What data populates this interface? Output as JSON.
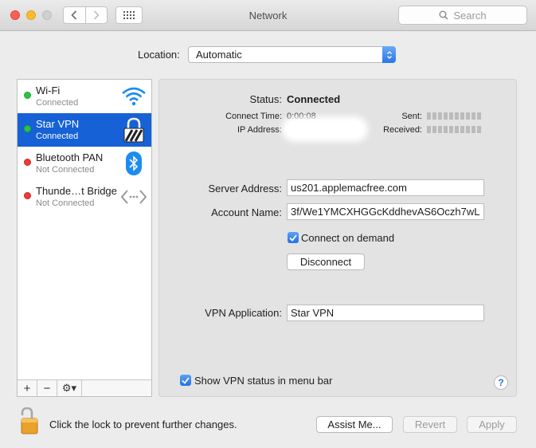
{
  "window": {
    "title": "Network"
  },
  "search": {
    "placeholder": "Search"
  },
  "location": {
    "label": "Location:",
    "value": "Automatic"
  },
  "services": [
    {
      "name": "Wi-Fi",
      "status": "Connected",
      "dot": "green",
      "icon": "wifi-icon"
    },
    {
      "name": "Star VPN",
      "status": "Connected",
      "dot": "green",
      "icon": "vpn-lock-icon",
      "selected": true
    },
    {
      "name": "Bluetooth PAN",
      "status": "Not Connected",
      "dot": "red",
      "icon": "bluetooth-icon"
    },
    {
      "name": "Thunde…t Bridge",
      "status": "Not Connected",
      "dot": "red",
      "icon": "thunderbolt-bridge-icon"
    }
  ],
  "sidebar_footer": {
    "add": "+",
    "remove": "−",
    "gear": "⚙▾"
  },
  "detail": {
    "status_label": "Status:",
    "status_value": "Connected",
    "connect_time_label": "Connect Time:",
    "connect_time_value": "0:00:08",
    "ip_label": "IP Address:",
    "sent_label": "Sent:",
    "received_label": "Received:",
    "server_label": "Server Address:",
    "server_value": "us201.applemacfree.com",
    "account_label": "Account Name:",
    "account_value": "3f/We1YMCXHGGcKddhevAS6Oczh7wL",
    "connect_on_demand": "Connect on demand",
    "disconnect": "Disconnect",
    "vpn_app_label": "VPN Application:",
    "vpn_app_value": "Star VPN",
    "show_status": "Show VPN status in menu bar",
    "help": "?"
  },
  "bottom": {
    "lock_text": "Click the lock to prevent further changes.",
    "assist": "Assist Me...",
    "revert": "Revert",
    "apply": "Apply"
  },
  "colors": {
    "selection": "#1661d5",
    "connected": "#29c53f",
    "disconnected": "#ec3b38",
    "accent": "#2a76e8"
  }
}
